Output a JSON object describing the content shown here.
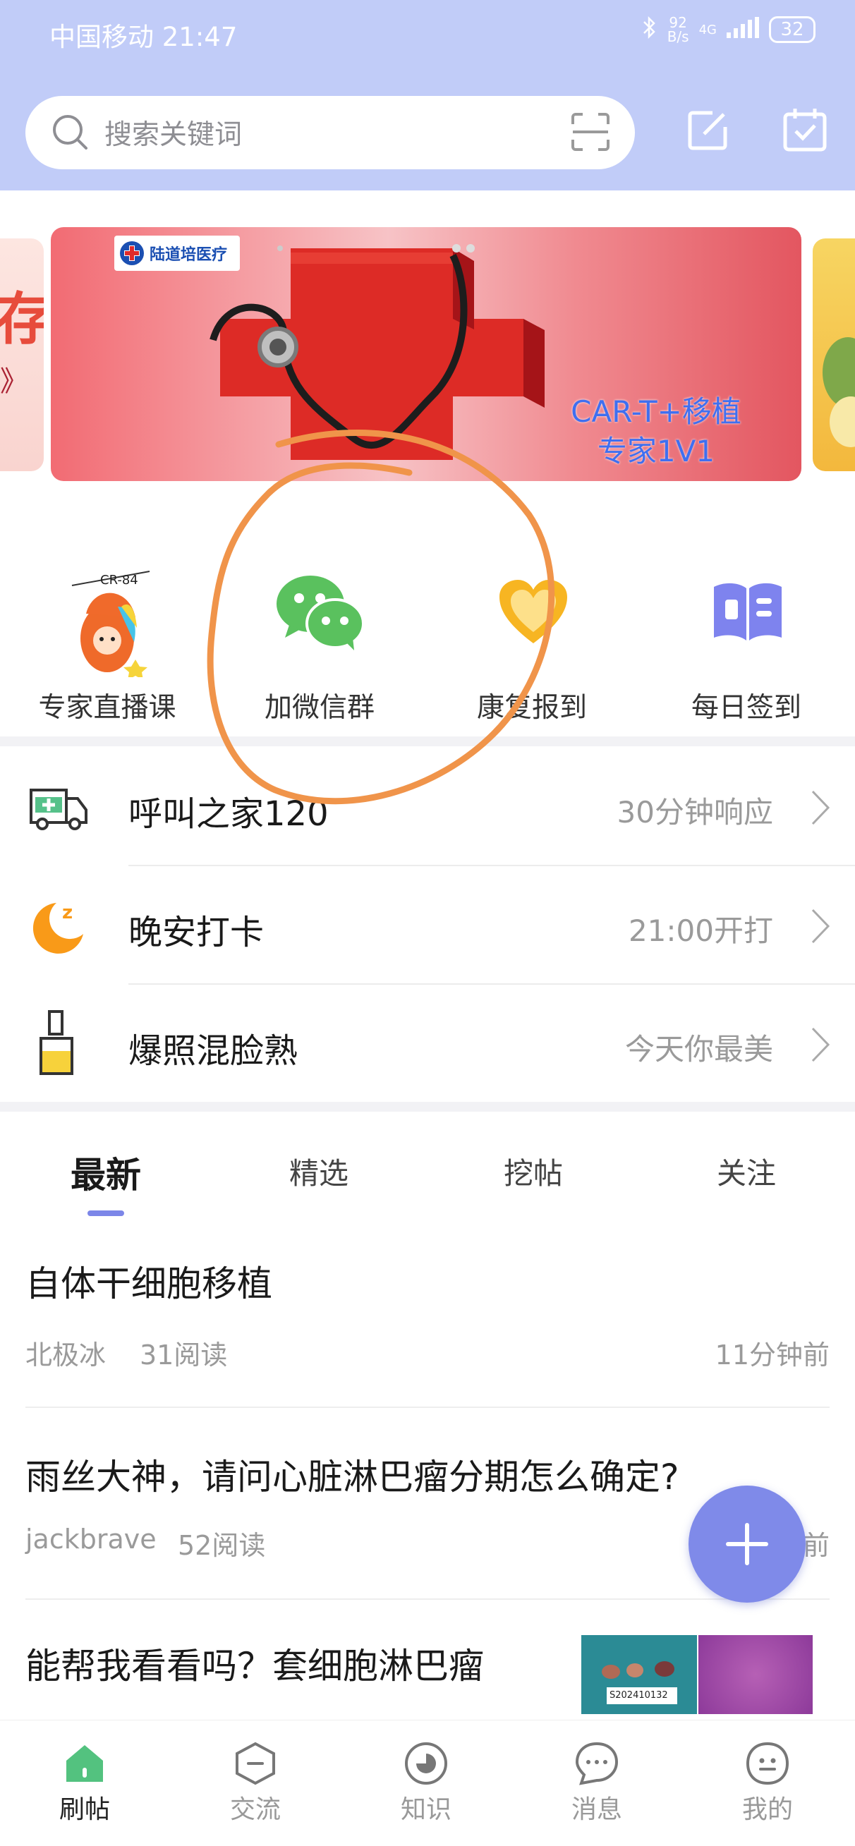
{
  "status_bar": {
    "carrier_time": "中国移动 21:47",
    "net_speed_top": "92",
    "net_speed_bottom": "B/s",
    "signal": "4G",
    "battery": "32"
  },
  "search": {
    "placeholder": "搜索关键词"
  },
  "banner": {
    "logo_text": "陆道培医疗",
    "headline_line1": "CAR-T+移植",
    "headline_line2": "专家1V1",
    "left_peek_glyph": "存",
    "left_peek_glyph2": "》",
    "sticker_text": "CR-84"
  },
  "quick_entries": [
    {
      "label": "专家直播课",
      "icon": "mascot-sticker-icon"
    },
    {
      "label": "加微信群",
      "icon": "wechat-icon"
    },
    {
      "label": "康复报到",
      "icon": "heart-icon"
    },
    {
      "label": "每日签到",
      "icon": "book-icon"
    }
  ],
  "list_rows": [
    {
      "title": "呼叫之家120",
      "meta": "30分钟响应",
      "icon": "ambulance-icon"
    },
    {
      "title": "晚安打卡",
      "meta": "21:00开打",
      "icon": "moon-icon"
    },
    {
      "title": "爆照混脸熟",
      "meta": "今天你最美",
      "icon": "lipstick-icon"
    }
  ],
  "tabs": [
    {
      "label": "最新",
      "active": true
    },
    {
      "label": "精选",
      "active": false
    },
    {
      "label": "挖帖",
      "active": false
    },
    {
      "label": "关注",
      "active": false
    }
  ],
  "posts": [
    {
      "title": "自体干细胞移植",
      "author": "北极冰",
      "reads": "31阅读",
      "time": "11分钟前"
    },
    {
      "title": "雨丝大神，请问心脏淋巴瘤分期怎么确定?",
      "author": "jackbrave",
      "reads": "52阅读",
      "time": "前"
    },
    {
      "title": "能帮我看看吗？套细胞淋巴瘤",
      "thumb_label": "S202410132"
    }
  ],
  "bottom_nav": [
    {
      "label": "刷帖",
      "active": true
    },
    {
      "label": "交流",
      "active": false
    },
    {
      "label": "知识",
      "active": false
    },
    {
      "label": "消息",
      "active": false
    },
    {
      "label": "我的",
      "active": false
    }
  ],
  "colors": {
    "header": "#c1ccf8",
    "accent": "#7f8ae9",
    "wechat": "#5ac15e",
    "annotation": "#f0944a"
  }
}
